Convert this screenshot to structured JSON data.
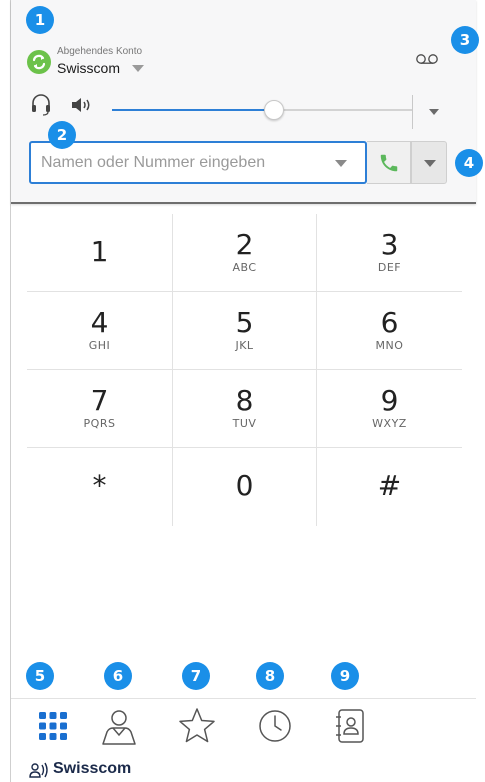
{
  "account": {
    "label": "Abgehendes Konto",
    "name": "Swisscom"
  },
  "volume": {
    "level_percent": 54
  },
  "dial": {
    "placeholder": "Namen oder Nummer eingeben",
    "value": ""
  },
  "keypad": [
    [
      {
        "digit": "1",
        "letters": ""
      },
      {
        "digit": "2",
        "letters": "ABC"
      },
      {
        "digit": "3",
        "letters": "DEF"
      }
    ],
    [
      {
        "digit": "4",
        "letters": "GHI"
      },
      {
        "digit": "5",
        "letters": "JKL"
      },
      {
        "digit": "6",
        "letters": "MNO"
      }
    ],
    [
      {
        "digit": "7",
        "letters": "PQRS"
      },
      {
        "digit": "8",
        "letters": "TUV"
      },
      {
        "digit": "9",
        "letters": "WXYZ"
      }
    ],
    [
      {
        "digit": "*",
        "letters": ""
      },
      {
        "digit": "0",
        "letters": ""
      },
      {
        "digit": "#",
        "letters": ""
      }
    ]
  ],
  "tabs": [
    {
      "name": "keypad",
      "icon": "keypad-icon"
    },
    {
      "name": "contact",
      "icon": "person-icon"
    },
    {
      "name": "favorites",
      "icon": "star-icon"
    },
    {
      "name": "history",
      "icon": "clock-icon"
    },
    {
      "name": "address-book",
      "icon": "address-book-icon"
    }
  ],
  "badges": [
    "1",
    "2",
    "3",
    "4",
    "5",
    "6",
    "7",
    "8",
    "9"
  ],
  "brand": {
    "name": "Swisscom"
  },
  "colors": {
    "accent": "#2d7fd6",
    "badge": "#1a8fe8",
    "call_green": "#5cb85c",
    "account_green": "#6cc24a"
  }
}
